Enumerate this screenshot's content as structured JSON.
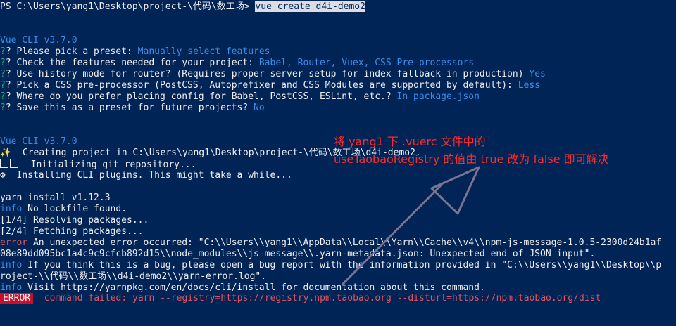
{
  "prompt": "PS C:\\Users\\yang1\\Desktop\\project-\\代码\\数工场> ",
  "command": "vue create d4i-demo2",
  "vue_cli_header_1": "Vue CLI v3.7.0",
  "questions": [
    {
      "q": "? Please pick a preset: ",
      "a": "Manually select features"
    },
    {
      "q": "? Check the features needed for your project: ",
      "a": "Babel, Router, Vuex, CSS Pre-processors"
    },
    {
      "q": "? Use history mode for router? (Requires proper server setup for index fallback in production) ",
      "a": "Yes"
    },
    {
      "q": "? Pick a CSS pre-processor (PostCSS, Autoprefixer and CSS Modules are supported by default): ",
      "a": "Less"
    },
    {
      "q": "? Where do you prefer placing config for Babel, PostCSS, ESLint, etc.? ",
      "a": "In package.json"
    },
    {
      "q": "? Save this as a preset for future projects? ",
      "a": "No"
    }
  ],
  "vue_cli_header_2": "Vue CLI v3.7.0",
  "creating": "  Creating project in C:\\Users\\yang1\\Desktop\\project-\\代码\\数工场\\d4i-demo2.",
  "init_git": "  Initializing git repository...",
  "installing": "  Installing CLI plugins. This might take a while...",
  "yarn_install": "yarn install v1.12.3",
  "info_no_lockfile": {
    "tag": "info",
    "text": " No lockfile found."
  },
  "resolving": "[1/4] Resolving packages...",
  "fetching": "[2/4] Fetching packages...",
  "error_line_1": {
    "tag": "error",
    "text": " An unexpected error occurred: \"C:\\\\Users\\\\yang1\\\\AppData\\\\Local\\\\Yarn\\\\Cache\\\\v4\\\\npm-js-message-1.0.5-2300d24b1af"
  },
  "error_line_2": "08e89dd095bc1a4c9c9cfcb892d15\\\\node_modules\\\\js-message\\\\.yarn-metadata.json: Unexpected end of JSON input\".",
  "info_bug_1": {
    "tag": "info",
    "text": " If you think this is a bug, please open a bug report with the information provided in \"C:\\\\Users\\\\yang1\\\\Desktop\\\\p"
  },
  "info_bug_2": "roject-\\\\代码\\\\数工场\\\\d4i-demo2\\\\yarn-error.log\".",
  "info_visit": {
    "tag": "info",
    "text": " Visit https://yarnpkg.com/en/docs/cli/install for documentation about this command."
  },
  "error_badge": "ERROR",
  "command_failed": "  command failed: yarn --registry=https://registry.npm.taobao.org --disturl=https://npm.taobao.org/dist",
  "annotation_line_1": "将 yang1 下 .vuerc 文件中的",
  "annotation_line_2": "useTaobaoRegistry 的值由 true 改为 false 即可解决",
  "colors": {
    "background": "#012456",
    "foreground": "#eeedf0",
    "answer": "#3b8eea",
    "question_mark": "#0dbc79",
    "error": "#e05561",
    "annotation": "#ff2b2b"
  }
}
